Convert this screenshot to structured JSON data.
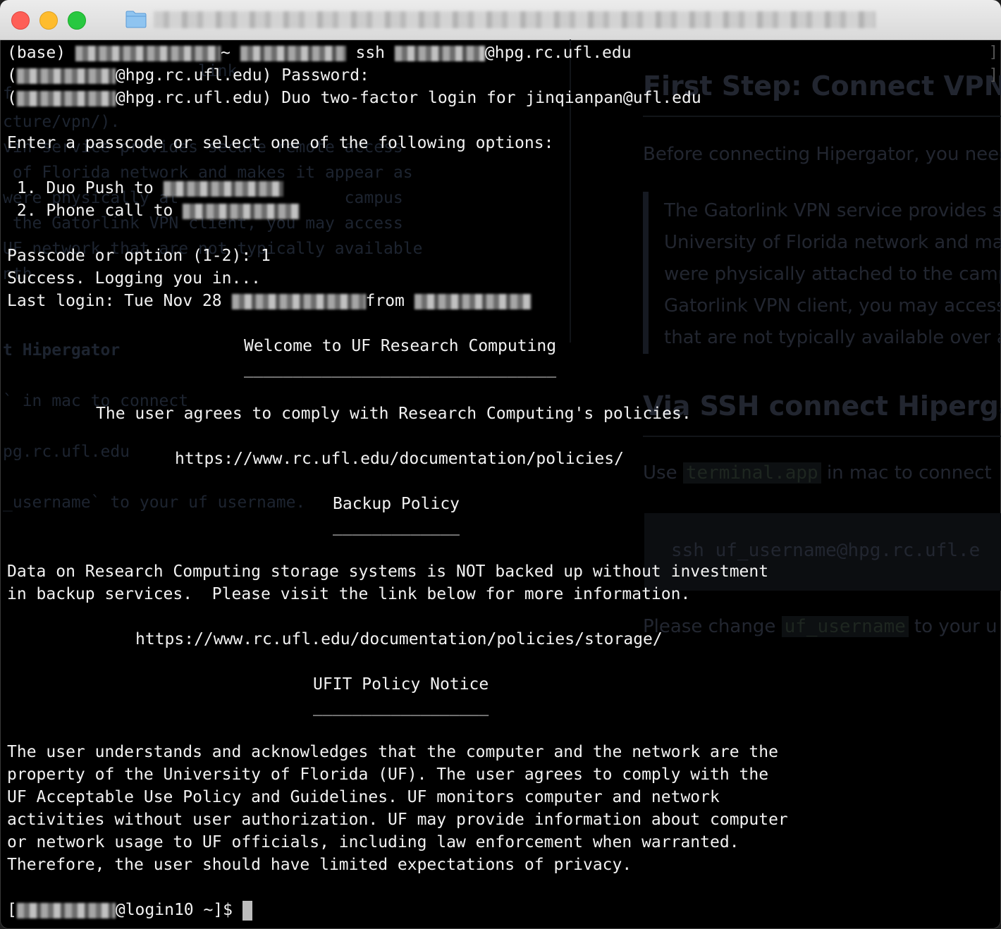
{
  "titlebar": {
    "folder_icon": "folder-icon"
  },
  "terminal": {
    "lines": [
      {
        "pre": "(base) ",
        "mid1": "~ ",
        "mid2": " ssh ",
        "post": "@hpg.rc.ufl.edu"
      },
      {
        "pre": "(",
        "post": "@hpg.rc.ufl.edu) Password:"
      },
      {
        "pre": "(",
        "post": "@hpg.rc.ufl.edu) Duo two-factor login for jinqianpan@ufl.edu"
      }
    ],
    "enter_prompt": "Enter a passcode or select one of the following options:",
    "option1": " 1. Duo Push to ",
    "option2": " 2. Phone call to ",
    "passcode_line": "Passcode or option (1-2): 1",
    "success_line": "Success. Logging you in...",
    "last_login_pre": "Last login: Tue Nov 28 ",
    "last_login_from": "from ",
    "welcome": "Welcome to UF Research Computing",
    "welcome_rule": "________________________________",
    "agree_line": "The user agrees to comply with Research Computing's policies.",
    "policies_url": "https://www.rc.ufl.edu/documentation/policies/",
    "backup_title": "Backup Policy",
    "backup_rule": "_____________",
    "backup_text1": "Data on Research Computing storage systems is NOT backed up without investment",
    "backup_text2": "in backup services.  Please visit the link below for more information.",
    "storage_url": "https://www.rc.ufl.edu/documentation/policies/storage/",
    "ufit_title": "UFIT Policy Notice",
    "ufit_rule": "__________________",
    "ufit_text": [
      "The user understands and acknowledges that the computer and the network are the",
      "property of the University of Florida (UF). The user agrees to comply with the",
      "UF Acceptable Use Policy and Guidelines. UF monitors computer and network",
      "activities without user authorization. UF may provide information about computer",
      "or network usage to UF officials, including law enforcement when warranted.",
      "Therefore, the user should have limited expectations of privacy."
    ],
    "prompt_pre": "[",
    "prompt_post": "@login10 ~]$ "
  },
  "background_doc": {
    "left_fragments": [
      "                    link",
      "f",
      "cture/vpn/).",
      "vin service provides secure remote access",
      " of Florida network and makes it appear as",
      "were physically at                 campus",
      " the Gatorlink VPN client, you may access",
      "UF network that are not typically available",
      "nth",
      "t Hipergator",
      "` in mac to connect",
      "pg.rc.ufl.edu",
      "_username` to your uf username."
    ],
    "heading1": "First Step: Connect VPN",
    "para1": "Before connecting Hipergator, you need",
    "quote": [
      "The Gatorlink VPN service provides s",
      "University of Florida network and mak",
      "were physically attached to the camp",
      "Gatorlink VPN client, you may access",
      "that are not typically available over ar"
    ],
    "heading2": "Via SSH connect Hipergato",
    "para2_pre": "Use ",
    "para2_code": "terminal.app",
    "para2_post": " in mac to connect",
    "code_block": "ssh uf_username@hpg.rc.ufl.e",
    "para3_pre": "Please change ",
    "para3_code": "uf_username",
    "para3_post": " to your u"
  }
}
